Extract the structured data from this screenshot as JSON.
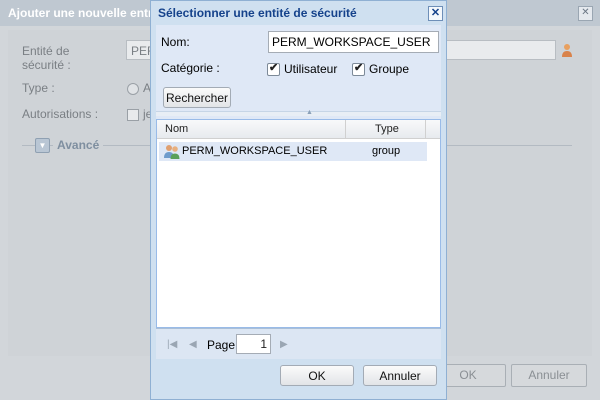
{
  "background_dialog": {
    "title": "Ajouter une nouvelle entrée",
    "close_glyph": "✕",
    "fields": {
      "security_label": "Entité de sécurité :",
      "security_value": "PER",
      "type_label": "Type :",
      "type_value": "A",
      "perms_label": "Autorisations :",
      "perms_value": "je"
    },
    "advanced_label": "Avancé",
    "ok_label": "OK",
    "cancel_label": "Annuler"
  },
  "dialog": {
    "title": "Sélectionner une entité de sécurité",
    "close_glyph": "✕",
    "name_label": "Nom:",
    "name_value": "PERM_WORKSPACE_USER",
    "category_label": "Catégorie :",
    "categories": [
      {
        "label": "Utilisateur",
        "checked": true
      },
      {
        "label": "Groupe",
        "checked": true
      }
    ],
    "search_label": "Rechercher",
    "grid": {
      "columns": [
        "Nom",
        "Type"
      ],
      "rows": [
        {
          "name": "PERM_WORKSPACE_USER",
          "type": "group",
          "icon": "group-icon",
          "selected": true
        }
      ]
    },
    "pager": {
      "page_label": "Page",
      "page_value": "1"
    },
    "ok_label": "OK",
    "cancel_label": "Annuler"
  },
  "colors": {
    "dialog_border": "#8fb0d3",
    "title_text": "#15428b",
    "selected_row": "#dfe8f6"
  }
}
